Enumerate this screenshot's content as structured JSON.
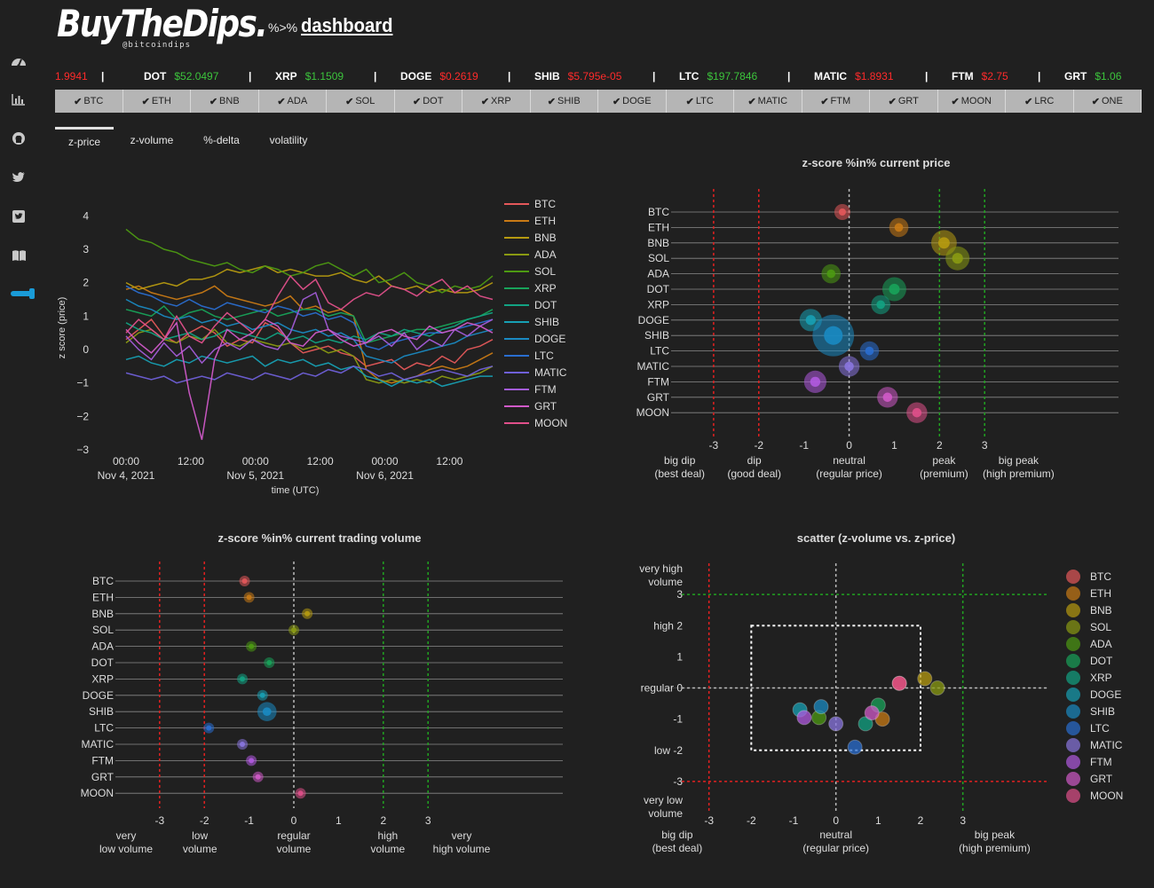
{
  "header": {
    "logo": "BuyTheDips.",
    "handle": "@bitcoindips",
    "prefix": "%>%",
    "dashboard_link": "dashboard"
  },
  "sidebar": {
    "items": [
      {
        "icon": "gauge-icon"
      },
      {
        "icon": "bar-chart-icon"
      },
      {
        "icon": "github-icon"
      },
      {
        "icon": "twitter-icon"
      },
      {
        "icon": "twitter-square-icon"
      },
      {
        "icon": "book-icon"
      },
      {
        "icon": "toggle-icon"
      }
    ]
  },
  "ticker": [
    {
      "sym": "",
      "price": "1.9941",
      "dir": "down"
    },
    {
      "sym": "DOT",
      "price": "$52.0497",
      "dir": "up"
    },
    {
      "sym": "XRP",
      "price": "$1.1509",
      "dir": "up"
    },
    {
      "sym": "DOGE",
      "price": "$0.2619",
      "dir": "down"
    },
    {
      "sym": "SHIB",
      "price": "$5.795e-05",
      "dir": "down"
    },
    {
      "sym": "LTC",
      "price": "$197.7846",
      "dir": "up"
    },
    {
      "sym": "MATIC",
      "price": "$1.8931",
      "dir": "down"
    },
    {
      "sym": "FTM",
      "price": "$2.75",
      "dir": "down"
    },
    {
      "sym": "GRT",
      "price": "$1.06",
      "dir": "up"
    }
  ],
  "coin_buttons": [
    "BTC",
    "ETH",
    "BNB",
    "ADA",
    "SOL",
    "DOT",
    "XRP",
    "SHIB",
    "DOGE",
    "LTC",
    "MATIC",
    "FTM",
    "GRT",
    "MOON",
    "LRC",
    "ONE"
  ],
  "tabs": [
    {
      "label": "z-price",
      "active": true
    },
    {
      "label": "z-volume",
      "active": false
    },
    {
      "label": "%-delta",
      "active": false
    },
    {
      "label": "volatility",
      "active": false
    }
  ],
  "chart_data": [
    {
      "type": "line",
      "title": "",
      "xlabel": "time (UTC)",
      "ylabel": "z score (price)",
      "ylim": [
        -3,
        4.3
      ],
      "yticks": [
        "4",
        "3",
        "2",
        "1",
        "0",
        "−1",
        "−2",
        "−3"
      ],
      "xticks": [
        {
          "t": 0,
          "l1": "00:00",
          "l2": "Nov 4, 2021"
        },
        {
          "t": 12,
          "l1": "12:00",
          "l2": ""
        },
        {
          "t": 24,
          "l1": "00:00",
          "l2": "Nov 5, 2021"
        },
        {
          "t": 36,
          "l1": "12:00",
          "l2": ""
        },
        {
          "t": 48,
          "l1": "00:00",
          "l2": "Nov 6, 2021"
        },
        {
          "t": 60,
          "l1": "12:00",
          "l2": ""
        }
      ],
      "series": [
        {
          "name": "BTC",
          "color": "#e4585a",
          "values": [
            0.3,
            0.6,
            0.9,
            0.4,
            0.2,
            0.5,
            0.7,
            0.5,
            0.1,
            0.3,
            0.2,
            0.8,
            0.6,
            0.2,
            -0.1,
            0.0,
            0.1,
            -0.1,
            -0.2,
            -0.5,
            -0.4,
            -0.3,
            -0.6,
            -0.4,
            -0.5,
            -0.2,
            -0.4,
            0.0,
            0.1,
            0.3
          ]
        },
        {
          "name": "ETH",
          "color": "#c97a15",
          "values": [
            1.8,
            1.9,
            1.7,
            1.6,
            1.5,
            1.6,
            1.7,
            1.9,
            1.6,
            1.5,
            1.4,
            1.3,
            1.4,
            1.6,
            1.2,
            1.3,
            1.1,
            1.2,
            1.0,
            -0.6,
            -0.9,
            -1.0,
            -0.9,
            -0.8,
            -0.6,
            -0.5,
            -0.6,
            -0.5,
            -0.3,
            -0.1
          ]
        },
        {
          "name": "BNB",
          "color": "#b69a10",
          "values": [
            2.0,
            1.8,
            1.9,
            2.0,
            1.9,
            2.1,
            2.1,
            2.2,
            2.4,
            2.3,
            2.4,
            2.5,
            2.3,
            2.4,
            2.3,
            2.2,
            2.2,
            2.3,
            2.1,
            2.0,
            2.2,
            1.9,
            1.8,
            1.9,
            1.7,
            1.8,
            1.7,
            1.7,
            1.8,
            2.0
          ]
        },
        {
          "name": "ADA",
          "color": "#8a9a12",
          "values": [
            0.2,
            0.5,
            0.6,
            0.3,
            0.2,
            0.4,
            0.3,
            0.6,
            0.2,
            0.1,
            0.3,
            0.2,
            0.1,
            0.2,
            0.0,
            0.1,
            -0.1,
            0.0,
            -0.2,
            -0.9,
            -1.0,
            -0.9,
            -1.0,
            -0.9,
            -1.0,
            -0.8,
            -0.9,
            -0.8,
            -0.7,
            -0.5
          ]
        },
        {
          "name": "SOL",
          "color": "#4d9a12",
          "values": [
            3.6,
            3.3,
            3.2,
            3.0,
            2.9,
            2.7,
            2.6,
            2.5,
            2.6,
            2.4,
            2.3,
            2.5,
            2.4,
            2.2,
            2.3,
            2.5,
            2.6,
            2.4,
            2.2,
            2.4,
            2.0,
            2.1,
            2.3,
            2.0,
            1.9,
            1.7,
            1.9,
            1.8,
            1.9,
            2.2
          ]
        },
        {
          "name": "XRP",
          "color": "#18a35a",
          "values": [
            1.2,
            1.1,
            1.0,
            1.3,
            0.9,
            1.1,
            1.2,
            1.0,
            0.9,
            1.0,
            1.1,
            1.2,
            1.0,
            1.1,
            1.2,
            1.2,
            1.0,
            1.1,
            1.0,
            0.2,
            0.3,
            0.4,
            0.5,
            0.6,
            0.6,
            0.7,
            0.8,
            0.9,
            1.0,
            1.2
          ]
        },
        {
          "name": "DOT",
          "color": "#12a383",
          "values": [
            0.8,
            0.6,
            0.5,
            0.3,
            0.4,
            0.5,
            0.3,
            0.4,
            0.6,
            0.5,
            0.4,
            0.3,
            0.5,
            0.3,
            0.4,
            0.2,
            0.3,
            0.2,
            0.4,
            0.3,
            0.5,
            0.4,
            0.6,
            0.5,
            0.4,
            0.6,
            0.7,
            0.9,
            1.0,
            1.1
          ]
        },
        {
          "name": "SHIB",
          "color": "#17a0b4",
          "values": [
            -0.3,
            -0.2,
            -0.4,
            -0.5,
            -0.3,
            -0.4,
            -0.2,
            -0.3,
            -0.4,
            -0.3,
            -0.2,
            -0.5,
            -0.3,
            -0.4,
            -0.3,
            -0.5,
            -0.4,
            -0.6,
            -0.5,
            -0.8,
            -0.9,
            -1.1,
            -0.9,
            -1.0,
            -0.9,
            -1.1,
            -1.0,
            -0.9,
            -0.8,
            -0.8
          ]
        },
        {
          "name": "DOGE",
          "color": "#1a8ac2",
          "values": [
            1.5,
            1.3,
            1.2,
            1.0,
            0.9,
            1.0,
            0.8,
            0.9,
            0.7,
            0.8,
            0.6,
            0.7,
            0.8,
            0.6,
            0.5,
            0.6,
            0.4,
            0.5,
            0.3,
            -0.2,
            -0.3,
            -0.4,
            -0.2,
            -0.1,
            0.0,
            0.1,
            0.2,
            0.4,
            0.5,
            0.6
          ]
        },
        {
          "name": "LTC",
          "color": "#2a6ed0",
          "values": [
            1.9,
            1.7,
            1.6,
            1.4,
            1.3,
            1.5,
            1.3,
            1.2,
            1.4,
            1.3,
            1.2,
            1.1,
            1.3,
            1.2,
            1.0,
            1.1,
            0.9,
            1.0,
            0.8,
            0.1,
            0.0,
            0.2,
            0.3,
            0.4,
            0.5,
            0.5,
            0.6,
            0.7,
            0.8,
            0.9
          ]
        },
        {
          "name": "MATIC",
          "color": "#6f60d8",
          "values": [
            -0.7,
            -0.8,
            -0.9,
            -0.8,
            -1.0,
            -0.9,
            -0.8,
            -0.9,
            -0.7,
            -0.8,
            -0.9,
            -0.7,
            -0.8,
            -0.9,
            -0.7,
            -0.8,
            -0.6,
            -0.7,
            -0.5,
            -0.6,
            -0.8,
            -0.7,
            -0.9,
            -0.8,
            -0.7,
            -0.6,
            -0.7,
            -0.8,
            -0.6,
            -0.5
          ]
        },
        {
          "name": "FTM",
          "color": "#a35cd8",
          "values": [
            0.4,
            0.0,
            -0.3,
            0.2,
            -0.2,
            0.1,
            -0.4,
            0.0,
            0.2,
            0.0,
            0.3,
            0.1,
            0.0,
            0.5,
            1.5,
            1.7,
            0.6,
            0.4,
            0.3,
            0.2,
            0.4,
            0.1,
            0.5,
            0.0,
            0.3,
            0.1,
            0.6,
            0.4,
            0.7,
            0.9
          ]
        },
        {
          "name": "GRT",
          "color": "#d05ac8",
          "values": [
            0.6,
            0.2,
            -0.1,
            0.3,
            0.8,
            -1.3,
            -2.7,
            -0.3,
            0.6,
            0.3,
            0.5,
            0.9,
            0.7,
            0.2,
            0.1,
            0.5,
            0.6,
            0.3,
            0.1,
            0.2,
            0.5,
            0.6,
            0.4,
            0.3,
            0.7,
            0.5,
            0.6,
            0.8,
            0.7,
            0.5
          ]
        },
        {
          "name": "MOON",
          "color": "#e0508a",
          "values": [
            0.5,
            0.9,
            0.6,
            0.3,
            1.0,
            0.4,
            0.2,
            0.7,
            1.1,
            0.8,
            0.5,
            0.9,
            1.6,
            2.2,
            1.8,
            2.1,
            1.4,
            1.2,
            1.5,
            1.7,
            1.6,
            1.9,
            1.8,
            1.6,
            1.9,
            2.1,
            1.7,
            1.9,
            1.6,
            1.5
          ]
        }
      ]
    },
    {
      "type": "scatter",
      "title": "z-score %in% current price",
      "xlim": [
        -4,
        5
      ],
      "xticks": [
        "-3",
        "-2",
        "-1",
        "0",
        "1",
        "2",
        "3"
      ],
      "categories": [
        "BTC",
        "ETH",
        "BNB",
        "SOL",
        "ADA",
        "DOT",
        "XRP",
        "DOGE",
        "SHIB",
        "LTC",
        "MATIC",
        "FTM",
        "GRT",
        "MOON"
      ],
      "values": [
        -0.15,
        1.1,
        2.1,
        2.4,
        -0.4,
        1.0,
        0.7,
        -0.85,
        -0.35,
        0.45,
        0.0,
        -0.75,
        0.85,
        1.5
      ],
      "sizes": [
        1.0,
        1.2,
        1.6,
        1.5,
        1.2,
        1.5,
        1.2,
        1.4,
        2.6,
        1.2,
        1.3,
        1.4,
        1.3,
        1.3
      ],
      "colors": [
        "#e4585a",
        "#c97a15",
        "#b69a10",
        "#8a9a12",
        "#4d9a12",
        "#18a35a",
        "#12a383",
        "#17a0b4",
        "#1a8ac2",
        "#2a6ed0",
        "#8a76e0",
        "#b05ae0",
        "#d05ac8",
        "#e0508a"
      ],
      "threshold_lines": [
        {
          "x": -3,
          "color": "#e32020"
        },
        {
          "x": -2,
          "color": "#e32020"
        },
        {
          "x": 0,
          "color": "#bbbbbb"
        },
        {
          "x": 2,
          "color": "#21a321"
        },
        {
          "x": 3,
          "color": "#21a321"
        }
      ],
      "bottom_labels": [
        {
          "x": -3.75,
          "l1": "big dip",
          "l2": "(best deal)"
        },
        {
          "x": -2.1,
          "l1": "dip",
          "l2": "(good deal)"
        },
        {
          "x": 0,
          "l1": "neutral",
          "l2": "(regular price)"
        },
        {
          "x": 2.1,
          "l1": "peak",
          "l2": "(premium)"
        },
        {
          "x": 3.75,
          "l1": "big peak",
          "l2": "(high premium)"
        }
      ]
    },
    {
      "type": "scatter",
      "title": "z-score %in% current trading volume",
      "xlim": [
        -5,
        5
      ],
      "xticks": [
        "-3",
        "-2",
        "-1",
        "0",
        "1",
        "2",
        "3"
      ],
      "categories": [
        "BTC",
        "ETH",
        "BNB",
        "SOL",
        "ADA",
        "DOT",
        "XRP",
        "DOGE",
        "SHIB",
        "LTC",
        "MATIC",
        "FTM",
        "GRT",
        "MOON"
      ],
      "values": [
        -1.1,
        -1.0,
        0.3,
        0.0,
        -0.95,
        -0.55,
        -1.15,
        -0.7,
        -0.6,
        -1.9,
        -1.15,
        -0.95,
        -0.8,
        0.15
      ],
      "sizes": [
        1.0,
        1.0,
        1.0,
        1.0,
        1.0,
        1.0,
        1.0,
        1.0,
        1.8,
        1.0,
        1.0,
        1.0,
        1.0,
        1.0
      ],
      "colors": [
        "#e4585a",
        "#c97a15",
        "#b69a10",
        "#8a9a12",
        "#4d9a12",
        "#18a35a",
        "#12a383",
        "#17a0b4",
        "#1a8ac2",
        "#2a6ed0",
        "#8a76e0",
        "#b05ae0",
        "#d05ac8",
        "#e0508a"
      ],
      "threshold_lines": [
        {
          "x": -3,
          "color": "#e32020"
        },
        {
          "x": -2,
          "color": "#e32020"
        },
        {
          "x": 0,
          "color": "#bbbbbb"
        },
        {
          "x": 2,
          "color": "#21a321"
        },
        {
          "x": 3,
          "color": "#21a321"
        }
      ],
      "bottom_labels": [
        {
          "x": -3.75,
          "l1": "very",
          "l2": "low volume"
        },
        {
          "x": -2.1,
          "l1": "low",
          "l2": "volume"
        },
        {
          "x": 0,
          "l1": "regular",
          "l2": "volume"
        },
        {
          "x": 2.1,
          "l1": "high",
          "l2": "volume"
        },
        {
          "x": 3.75,
          "l1": "very",
          "l2": "high volume"
        }
      ]
    },
    {
      "type": "scatter",
      "title": "scatter (z-volume vs. z-price)",
      "xlim": [
        -4,
        5
      ],
      "ylim": [
        -4,
        4
      ],
      "xticks": [
        "-3",
        "-2",
        "-1",
        "0",
        "1",
        "2",
        "3"
      ],
      "yticks": [
        {
          "y": 3,
          "label": "3"
        },
        {
          "y": 2,
          "label": "high 2"
        },
        {
          "y": 1,
          "label": "1"
        },
        {
          "y": 0,
          "label": "regular 0"
        },
        {
          "y": -1,
          "label": "-1"
        },
        {
          "y": -2,
          "label": "low -2"
        },
        {
          "y": -3,
          "label": "-3"
        }
      ],
      "y_top_label": {
        "l1": "very high",
        "l2": "volume"
      },
      "y_bottom_label": {
        "l1": "very low",
        "l2": "volume"
      },
      "bottom_labels": [
        {
          "x": -3.75,
          "l1": "big dip",
          "l2": "(best deal)"
        },
        {
          "x": 0,
          "l1": "neutral",
          "l2": "(regular price)"
        },
        {
          "x": 3.75,
          "l1": "big peak",
          "l2": "(high premium)"
        }
      ],
      "points": [
        {
          "name": "BTC",
          "x": 1.5,
          "y": 0.15
        },
        {
          "name": "ETH",
          "x": 1.1,
          "y": -1.0
        },
        {
          "name": "BNB",
          "x": 2.1,
          "y": 0.3
        },
        {
          "name": "SOL",
          "x": 2.4,
          "y": 0.0
        },
        {
          "name": "ADA",
          "x": -0.4,
          "y": -0.95
        },
        {
          "name": "DOT",
          "x": 1.0,
          "y": -0.55
        },
        {
          "name": "XRP",
          "x": 0.7,
          "y": -1.15
        },
        {
          "name": "DOGE",
          "x": -0.85,
          "y": -0.7
        },
        {
          "name": "SHIB",
          "x": -0.35,
          "y": -0.6
        },
        {
          "name": "LTC",
          "x": 0.45,
          "y": -1.9
        },
        {
          "name": "MATIC",
          "x": 0.0,
          "y": -1.15
        },
        {
          "name": "FTM",
          "x": -0.75,
          "y": -0.95
        },
        {
          "name": "GRT",
          "x": 0.85,
          "y": -0.8
        },
        {
          "name": "MOON",
          "x": 1.5,
          "y": 0.15
        }
      ],
      "legend": [
        "BTC",
        "ETH",
        "BNB",
        "SOL",
        "ADA",
        "DOT",
        "XRP",
        "DOGE",
        "SHIB",
        "LTC",
        "MATIC",
        "FTM",
        "GRT",
        "MOON"
      ],
      "legend_colors": [
        "#e4585a",
        "#c97a15",
        "#b69a10",
        "#8a9a12",
        "#4d9a12",
        "#18a35a",
        "#12a383",
        "#17a0b4",
        "#1a8ac2",
        "#2a6ed0",
        "#8a76e0",
        "#b05ae0",
        "#d05ac8",
        "#e0508a"
      ],
      "hlines": [
        {
          "y": 3,
          "color": "#21a321"
        },
        {
          "y": 0,
          "color": "#bbbbbb"
        },
        {
          "y": -3,
          "color": "#e32020"
        }
      ],
      "vlines": [
        {
          "x": -3,
          "color": "#e32020"
        },
        {
          "x": 0,
          "color": "#bbbbbb"
        },
        {
          "x": 3,
          "color": "#21a321"
        }
      ],
      "box": {
        "x0": -2,
        "x1": 2,
        "y0": -2,
        "y1": 2
      }
    }
  ]
}
